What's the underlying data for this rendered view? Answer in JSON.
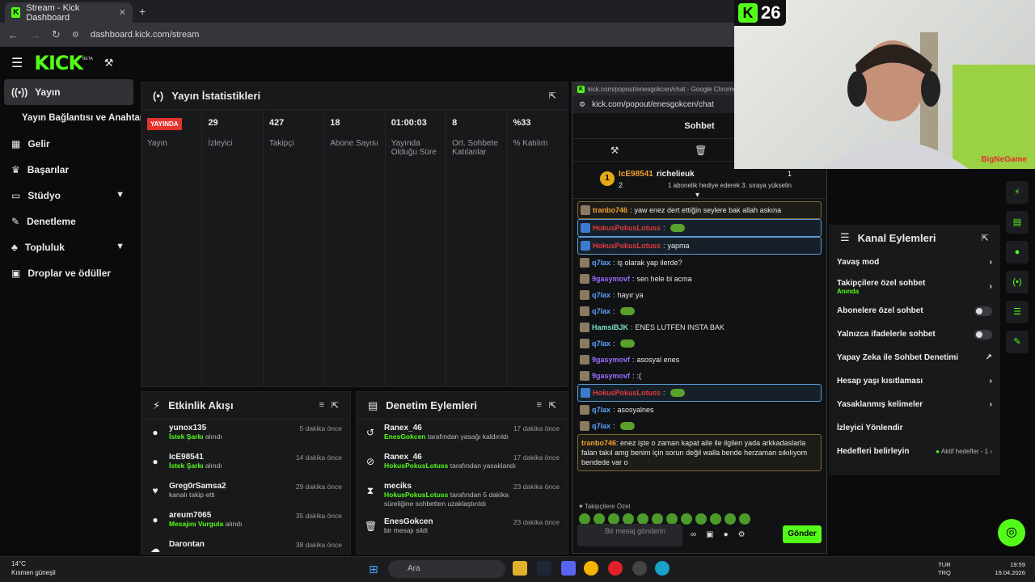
{
  "browser": {
    "tab_title": "Stream - Kick Dashboard",
    "url": "dashboard.kick.com/stream"
  },
  "header": {
    "logo": "KICK",
    "beta": "BETA"
  },
  "sidebar": {
    "items": [
      {
        "label": "Yayın",
        "icon": "broadcast-icon"
      },
      {
        "label": "Yayın Bağlantısı ve Anahtarı",
        "icon": ""
      },
      {
        "label": "Gelir",
        "icon": "chart-icon"
      },
      {
        "label": "Başarılar",
        "icon": "trophy-icon"
      },
      {
        "label": "Stüdyo",
        "icon": "studio-icon"
      },
      {
        "label": "Denetleme",
        "icon": "wrench-icon"
      },
      {
        "label": "Topluluk",
        "icon": "community-icon"
      },
      {
        "label": "Droplar ve ödüller",
        "icon": "gift-icon"
      }
    ]
  },
  "stats": {
    "title": "Yayın İstatistikleri",
    "items": [
      {
        "value": "YAYINDA",
        "label": "Yayın"
      },
      {
        "value": "29",
        "label": "İzleyici"
      },
      {
        "value": "427",
        "label": "Takipçi"
      },
      {
        "value": "18",
        "label": "Abone Sayısı"
      },
      {
        "value": "01:00:03",
        "label": "Yayında Olduğu Süre"
      },
      {
        "value": "8",
        "label": "Ort. Sohbete Katılanlar"
      },
      {
        "value": "%33",
        "label": "% Katılım"
      }
    ]
  },
  "events": {
    "title": "Etkinlik Akışı",
    "rows": [
      {
        "name": "yunox135",
        "detail_green": "İstek Şarkı",
        "detail": "alındı",
        "time": "5 dakika önce"
      },
      {
        "name": "IcE98541",
        "detail_green": "İstek Şarkı",
        "detail": "alındı",
        "time": "14 dakika önce"
      },
      {
        "name": "Greg0rSamsa2",
        "detail_green": "",
        "detail": "kanalı takip etti",
        "time": "29 dakika önce"
      },
      {
        "name": "areum7065",
        "detail_green": "Mesajını Vurgula",
        "detail": "alındı",
        "time": "35 dakika önce"
      },
      {
        "name": "Darontan",
        "detail_green": "",
        "detail": "",
        "time": "38 dakika önce"
      }
    ]
  },
  "modlog": {
    "title": "Denetim Eylemleri",
    "rows": [
      {
        "name": "Ranex_46",
        "detail_green": "EnesGokcen",
        "detail": "tarafından yasağı kaldırıldı",
        "time": "17 dakika önce"
      },
      {
        "name": "Ranex_46",
        "detail_green": "HokusPokusLotuss",
        "detail": "tarafından yasaklandı",
        "time": "17 dakika önce"
      },
      {
        "name": "meciks",
        "detail_green": "HokusPokusLotuss",
        "detail": "tarafından 5 dakika süreliğine sohbetten uzaklaştırıldı",
        "time": "23 dakika önce"
      },
      {
        "name": "EnesGokcen",
        "detail_green": "",
        "detail": "bir mesajı sildi",
        "time": "23 dakika önce"
      }
    ]
  },
  "chat": {
    "window_title": "kick.com/popout/enesgokcen/chat - Google Chrome",
    "url": "kick.com/popout/enesgokcen/chat",
    "header": "Sohbet",
    "pinned": {
      "rank": "1",
      "user1": "IcE98541",
      "count1": "2",
      "user2": "richelieuk",
      "count2": "1",
      "text": "1 abonelik hediye ederek 3. sıraya yükselin"
    },
    "messages": [
      {
        "user": "tranbo746",
        "text": "yaw enez dert ettiğin seylere bak allah askına",
        "style": "box",
        "color": "or"
      },
      {
        "user": "HokusPokusLotuss",
        "text": "",
        "style": "blue",
        "color": "red"
      },
      {
        "user": "HokusPokusLotuss",
        "text": "yapma",
        "style": "blue",
        "color": "red"
      },
      {
        "user": "q7lax",
        "text": "iş olarak yap ilerde?",
        "style": "",
        "color": "blue"
      },
      {
        "user": "9gasymovf",
        "text": "sen hele bi acma",
        "style": "",
        "color": "pur"
      },
      {
        "user": "q7lax",
        "text": "hayır ya",
        "style": "",
        "color": "blue"
      },
      {
        "user": "q7lax",
        "text": "",
        "style": "",
        "color": "blue"
      },
      {
        "user": "HamsiBJK",
        "text": "ENES LUTFEN INSTA BAK",
        "style": "",
        "color": "grn"
      },
      {
        "user": "q7lax",
        "text": "",
        "style": "",
        "color": "blue"
      },
      {
        "user": "9gasymovf",
        "text": "asosyal enes",
        "style": "",
        "color": "pur"
      },
      {
        "user": "9gasymovf",
        "text": ":(",
        "style": "",
        "color": "pur"
      },
      {
        "user": "HokusPokusLotuss",
        "text": "",
        "style": "blue",
        "color": "red"
      },
      {
        "user": "q7lax",
        "text": "asosyalnes",
        "style": "",
        "color": "blue"
      },
      {
        "user": "q7lax",
        "text": "",
        "style": "",
        "color": "blue"
      }
    ],
    "last_message": {
      "user": "tranbo746",
      "text": "enez işte o zaman kapat aile ile ilgilen yada arkkadaslarla falan takıl amg benim için sorun değil walla bende herzaman sıkılıyom bendede var o"
    },
    "emote_label": "Takipçilere Özel",
    "input_placeholder": "Bir mesaj gönderin",
    "send": "Gönder"
  },
  "overlay": {
    "number": "26",
    "watermark": "BigNeGame"
  },
  "channel_actions": {
    "title": "Kanal Eylemleri",
    "items": [
      {
        "label": "Yavaş mod",
        "sub": "",
        "control": "chevron"
      },
      {
        "label": "Takipçilere özel sohbet",
        "sub": "Anında",
        "control": "chevron"
      },
      {
        "label": "Abonelere özel sohbet",
        "sub": "",
        "control": "toggle"
      },
      {
        "label": "Yalnızca ifadelerle sohbet",
        "sub": "",
        "control": "toggle"
      },
      {
        "label": "Yapay Zeka ile Sohbet Denetimi",
        "sub": "",
        "control": "external"
      },
      {
        "label": "Hesap yaşı kısıtlaması",
        "sub": "",
        "control": "chevron"
      },
      {
        "label": "Yasaklanmış kelimeler",
        "sub": "",
        "control": "chevron"
      },
      {
        "label": "İzleyici Yönlendir",
        "sub": "",
        "control": ""
      },
      {
        "label": "Hedefleri belirleyin",
        "sub": "",
        "control": "chevron",
        "status": "Aktif hedefler - 1"
      }
    ]
  },
  "taskbar": {
    "temp": "14°C",
    "weather": "Kısmen güneşli",
    "search": "Ara",
    "lang1": "TUR",
    "lang2": "TRQ",
    "time": "19:59",
    "date": "19.04.2026"
  },
  "colors": {
    "accent": "#53fc18",
    "live": "#e5322d"
  }
}
